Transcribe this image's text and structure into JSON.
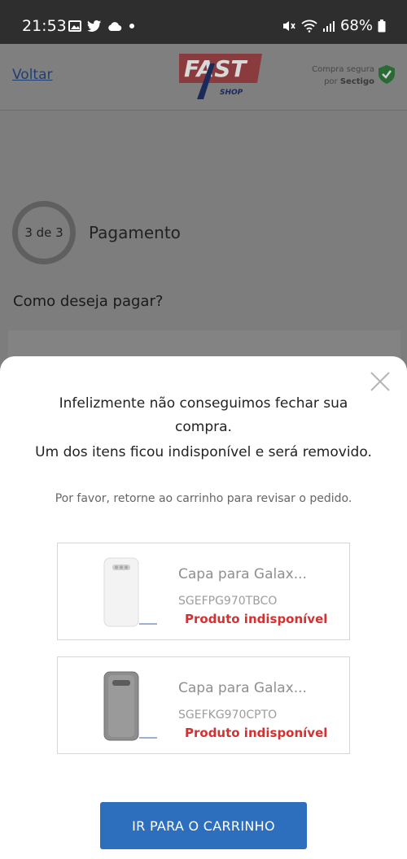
{
  "status_bar": {
    "time": "21:53",
    "battery": "68%",
    "left_icons": [
      "image-icon",
      "twitter-icon",
      "cloud-icon",
      "dot-icon"
    ],
    "right_icons": [
      "mute-icon",
      "wifi-icon",
      "signal-icon",
      "battery-icon"
    ]
  },
  "header": {
    "back_label": "Voltar",
    "logo_text": "FAST",
    "logo_sub": "SHOP",
    "secure_line1": "Compra segura",
    "secure_line2_prefix": "por ",
    "secure_brand": "Sectigo"
  },
  "checkout": {
    "step": "3 de 3",
    "step_title": "Pagamento",
    "payment_question": "Como deseja pagar?"
  },
  "modal": {
    "line1": "Infelizmente não conseguimos fechar sua compra.",
    "line2": "Um dos itens ficou indisponível e será removido.",
    "sub": "Por favor, retorne ao carrinho para revisar o pedido.",
    "items": [
      {
        "name": "Capa para Galax...",
        "sku": "SGEFPG970TBCO",
        "status": "Produto indisponível",
        "image_color": "#f2f2f2"
      },
      {
        "name": "Capa para Galax...",
        "sku": "SGEFKG970CPTO",
        "status": "Produto indisponível",
        "image_color": "#8c8c8c"
      }
    ],
    "cta": "IR PARA O CARRINHO"
  },
  "colors": {
    "accent": "#2d6fbd",
    "error": "#d13232",
    "logo_red": "#d8262f",
    "logo_blue": "#1f3a8a",
    "shield_green": "#2e9e3e"
  }
}
